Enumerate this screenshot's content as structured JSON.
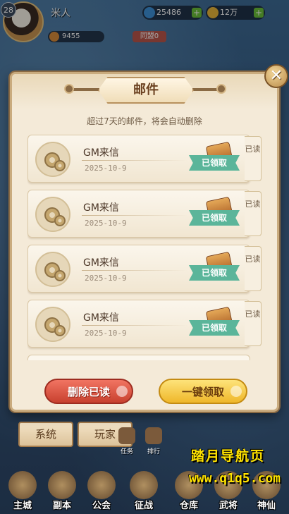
{
  "player": {
    "level": "28",
    "name": "米人",
    "gems": "25486",
    "gold": "12万",
    "power": "9455",
    "vip": "同盟0"
  },
  "dialog": {
    "title": "邮件",
    "notice": "超过7天的邮件，将会自动删除",
    "close_label": "✕",
    "mails": [
      {
        "title": "GM来信",
        "date": "2025-10-9",
        "status": "已领取",
        "read": "已读"
      },
      {
        "title": "GM来信",
        "date": "2025-10-9",
        "status": "已领取",
        "read": "已读"
      },
      {
        "title": "GM来信",
        "date": "2025-10-9",
        "status": "已领取",
        "read": "已读"
      },
      {
        "title": "GM来信",
        "date": "2025-10-9",
        "status": "已领取",
        "read": "已读"
      }
    ],
    "delete_read_label": "删除已读",
    "claim_all_label": "一键领取"
  },
  "tabs": [
    {
      "label": "系统"
    },
    {
      "label": "玩家"
    }
  ],
  "side_nav": [
    {
      "label": "任务"
    },
    {
      "label": "排行"
    }
  ],
  "bottom_nav": [
    {
      "label": "主城"
    },
    {
      "label": "副本"
    },
    {
      "label": "公会"
    },
    {
      "label": "征战"
    },
    {
      "label": "仓库"
    },
    {
      "label": "武将"
    },
    {
      "label": "神仙"
    }
  ],
  "watermark": {
    "line1": "踏月导航页",
    "line2": "www.q1q5.com"
  },
  "colors": {
    "claimed_tag": "#5bb59a",
    "delete_button": "#e0594a",
    "claim_button": "#f6c944",
    "title_text": "#6b4120"
  }
}
